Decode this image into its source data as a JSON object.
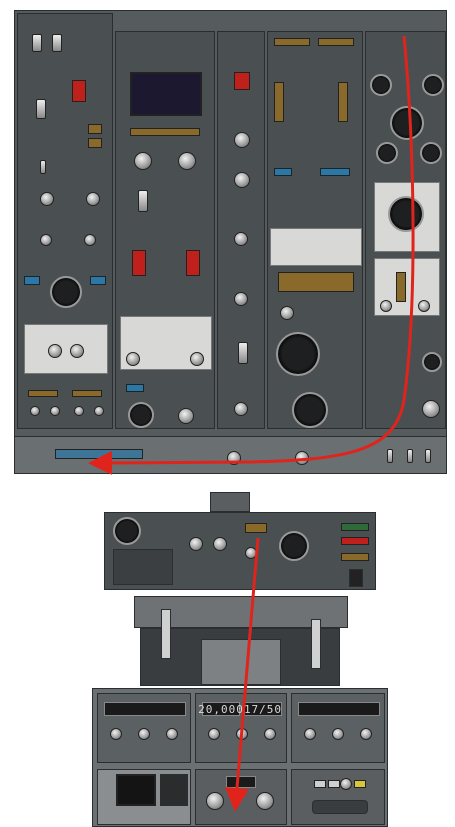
{
  "image": {
    "subject": "overhead-panel-and-pedestal",
    "arrow_color": "#e0241b",
    "display_digits": {
      "altitude_window": "20,000",
      "right_window": "17/50"
    }
  }
}
